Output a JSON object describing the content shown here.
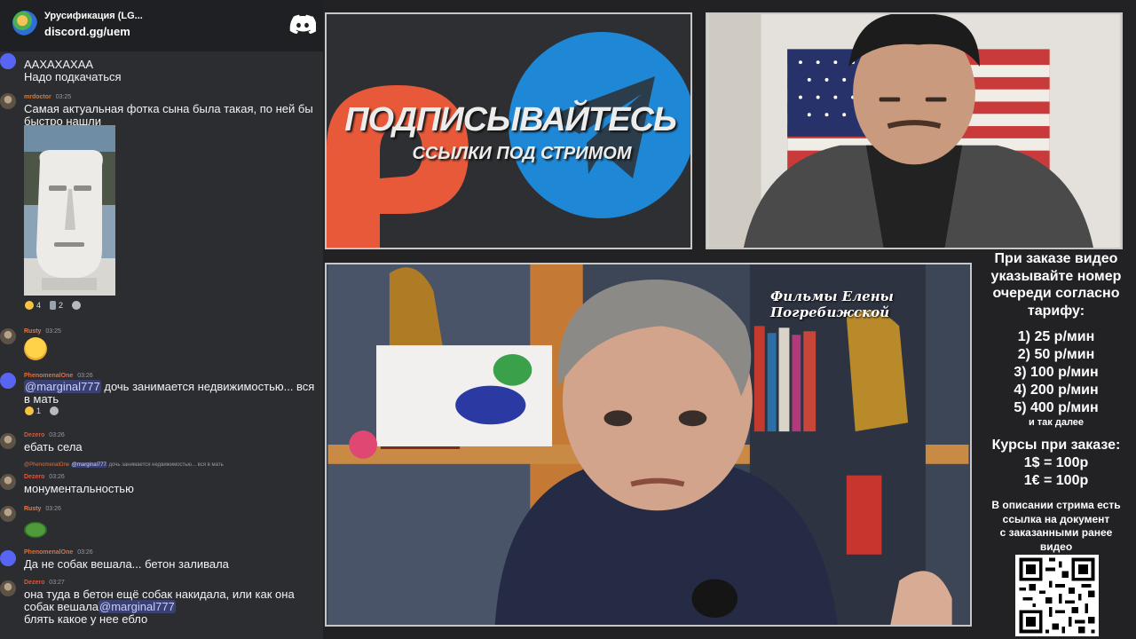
{
  "server": {
    "name": "Урусификация (LG...",
    "invite": "discord.gg/uem"
  },
  "messages": [
    {
      "lines": [
        "ААХАХАХАА",
        "Надо подкачаться"
      ]
    },
    {
      "user": "mrdoctor",
      "user_color": "#d97c2f",
      "time": "03:25",
      "text": "Самая актуальная фотка сына была такая, по ней бы быстро нашли",
      "reactions": [
        {
          "emoji": "laughing",
          "count": "4"
        },
        {
          "emoji": "trash",
          "count": "2"
        },
        {
          "emoji": "smile",
          "count": ""
        }
      ]
    },
    {
      "user": "Rusty",
      "user_color": "#e8794a",
      "time": "03:25",
      "emoji": "laughing-crying"
    },
    {
      "user": "PhenomenalOne",
      "user_color": "#e0703a",
      "time": "03:26",
      "mention": "@marginal777",
      "text": "дочь занимается недвижимостью... вся в мать",
      "reactions": [
        {
          "emoji": "laughing",
          "count": "1"
        },
        {
          "emoji": "smile",
          "count": ""
        }
      ]
    },
    {
      "user": "Dezero",
      "user_color": "#e0553a",
      "time": "03:26",
      "text": "ебать села"
    },
    {
      "reply_user": "@PhenomenalOne",
      "reply_mention": "@marginal777",
      "reply_text": "дочь занимается недвижимостью... вся в мать",
      "user": "Dezero",
      "user_color": "#e0553a",
      "time": "03:26",
      "text": "монументальностью"
    },
    {
      "user": "Rusty",
      "user_color": "#e8794a",
      "time": "03:26",
      "emoji": "pepe"
    },
    {
      "user": "PhenomenalOne",
      "user_color": "#e0703a",
      "time": "03:26",
      "text": "Да не собак вешала... бетон заливала"
    },
    {
      "user": "Dezero",
      "user_color": "#e0553a",
      "time": "03:27",
      "text": "она туда в бетон ещё собак накидала, или как она собак вешала",
      "mention": "@marginal777",
      "text2": "блять какое у нее ебло"
    }
  ],
  "banner": {
    "title": "ПОДПИСЫВАЙТЕСЬ",
    "subtitle": "ССЫЛКИ ПОД СТРИМОМ",
    "colors": {
      "patreon": "#e8593a",
      "telegram": "#1f88d6"
    }
  },
  "film": {
    "caption": "Фильмы Елены Погребижской"
  },
  "info": {
    "head": [
      "При заказе видео",
      "указывайте номер",
      "очереди согласно",
      "тарифу:"
    ],
    "tariffs": [
      "1) 25 р/мин",
      "2) 50 р/мин",
      "3) 100 р/мин",
      "4) 200 р/мин",
      "5) 400 р/мин"
    ],
    "tariff_note": "и так далее",
    "rates_head": "Курсы при заказе:",
    "rates": [
      "1$ = 100р",
      "1€ = 100р"
    ],
    "desc": [
      "В описании стрима есть",
      "ссылка на документ",
      "с заказанными ранее",
      "видео"
    ]
  }
}
